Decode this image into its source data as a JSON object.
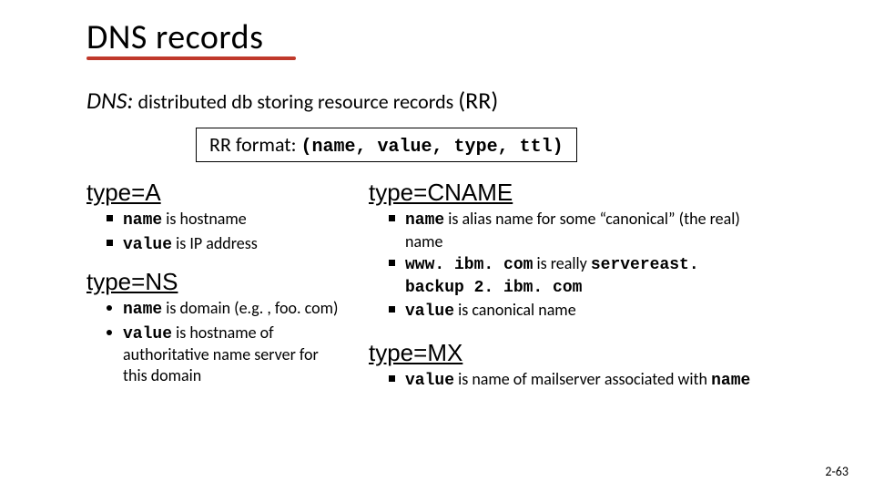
{
  "title": "DNS records",
  "subtitle": {
    "dns": "DNS:",
    "rest": " distributed db storing resource records ",
    "rr": "(RR)"
  },
  "format": {
    "label": "RR format: ",
    "tuple": "(name, value, type, ttl)"
  },
  "left": {
    "a": {
      "head": "type=A",
      "items": [
        {
          "k": "name",
          "rest": " is hostname"
        },
        {
          "k": "value",
          "rest": " is IP address"
        }
      ]
    },
    "ns": {
      "head": "type=NS",
      "items": [
        {
          "k": "name",
          "rest": " is domain (e.g. , foo. com)"
        },
        {
          "k": "value",
          "rest": " is hostname of authoritative name server for this domain"
        }
      ]
    }
  },
  "right": {
    "cname": {
      "head": "type=CNAME",
      "i1": {
        "k": "name",
        "rest": " is alias name for some “canonical” (the real) name"
      },
      "i2": {
        "a": "www. ibm. com",
        "mid": " is really ",
        "b": "servereast. backup 2. ibm. com"
      },
      "i3": {
        "k": "value",
        "rest": " is canonical name"
      }
    },
    "mx": {
      "head": "type=MX",
      "i1": {
        "k": "value",
        "mid": " is name of mailserver associated with ",
        "k2": "name"
      }
    }
  },
  "footer": "2-63"
}
